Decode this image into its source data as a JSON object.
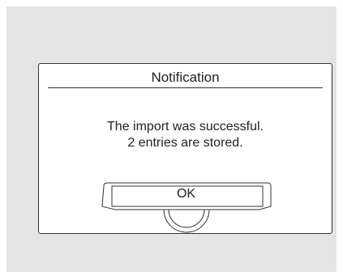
{
  "dialog": {
    "title": "Notification",
    "message_line1": "The import was successful.",
    "message_line2": "2 entries are stored.",
    "ok_label": "OK"
  },
  "colors": {
    "screen_background": "#e4e4e5",
    "dialog_background": "#ffffff",
    "border": "#333333",
    "text": "#222222"
  }
}
